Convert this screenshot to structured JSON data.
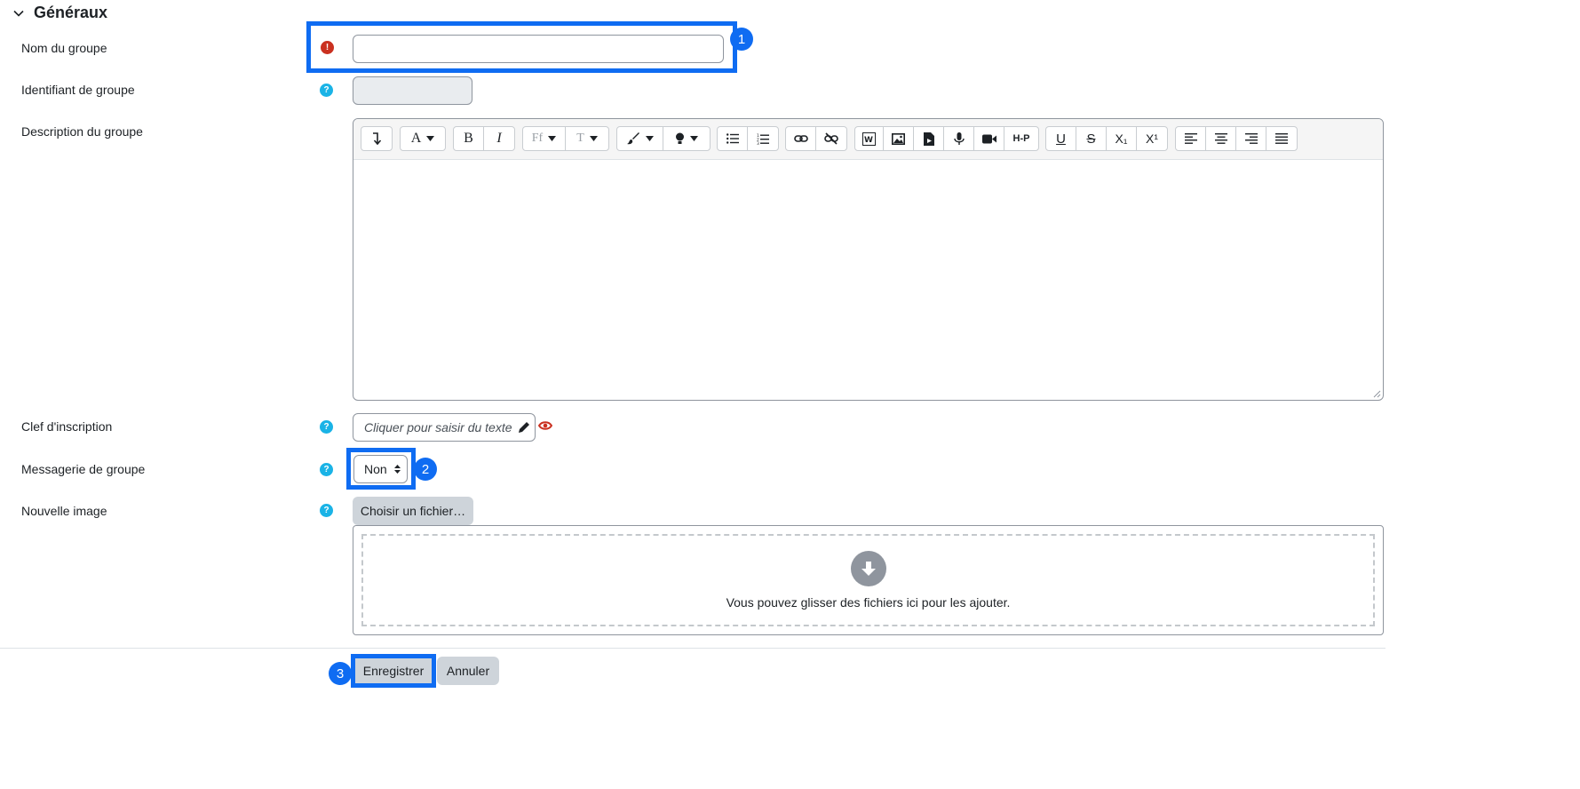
{
  "section": {
    "title": "Généraux"
  },
  "fields": {
    "group_name": {
      "label": "Nom du groupe",
      "value": ""
    },
    "group_id": {
      "label": "Identifiant de groupe",
      "value": ""
    },
    "description": {
      "label": "Description du groupe"
    },
    "enrolment_key": {
      "label": "Clef d'inscription",
      "placeholder": "Cliquer pour saisir du texte"
    },
    "messaging": {
      "label": "Messagerie de groupe",
      "value": "Non"
    },
    "new_picture": {
      "label": "Nouvelle image",
      "button": "Choisir un fichier…",
      "drop_text": "Vous pouvez glisser des fichiers ici pour les ajouter."
    }
  },
  "toolbar": {
    "font_family_short": "Ff",
    "font_size_short": "T",
    "h5p": "H-P",
    "subscript": "X₁",
    "superscript": "X¹"
  },
  "buttons": {
    "save": "Enregistrer",
    "cancel": "Annuler"
  },
  "badges": {
    "b1": "1",
    "b2": "2",
    "b3": "3"
  },
  "colors": {
    "accent": "#0f6cf2",
    "help": "#1ab3e6",
    "required": "#ca3120"
  }
}
